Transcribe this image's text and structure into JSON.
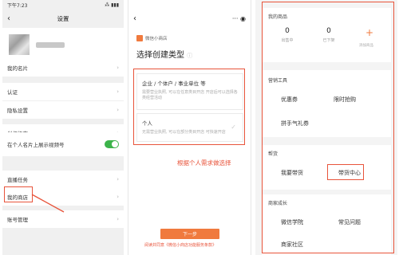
{
  "colors": {
    "accent": "#f07a3e",
    "annotation": "#e8543b",
    "toggle_on": "#3cb34a"
  },
  "panel1": {
    "status": {
      "time": "下午7:23",
      "right": "⁂ ▮▮▮"
    },
    "nav": {
      "back_icon": "chevron-left-icon",
      "title": "设置"
    },
    "items": [
      {
        "label": "我的名片"
      },
      {
        "label": "认证"
      },
      {
        "label": "隐私设置"
      },
      {
        "label": "创作指南"
      },
      {
        "label": "在个人名片上展示视频号"
      },
      {
        "label": "直播任务"
      },
      {
        "label": "我的商店"
      },
      {
        "label": "账号管理"
      }
    ]
  },
  "panel2": {
    "nav": {
      "back_icon": "chevron-left-icon"
    },
    "shop_label": "微信小商店",
    "title": "选择创建类型",
    "options": [
      {
        "label": "企业 / 个体户 / 事业单位 等",
        "desc": "需要营业执照, 可以在任意类目开店 开店后可以选择各类经营活动"
      },
      {
        "label": "个人",
        "desc": "无需营业执照, 可以在部分类目开店 可快速开店"
      }
    ],
    "annotation": "根据个人需求做选择",
    "next_button": "下一步",
    "agree_text": "阅读并同意《微信小商店功能服务条款》"
  },
  "panel3": {
    "section_goods": {
      "title": "我的商品",
      "stats": [
        {
          "value": "0",
          "label": "出售中"
        },
        {
          "value": "0",
          "label": "已下架"
        }
      ],
      "add_label": "添加商品"
    },
    "section_tools": {
      "title": "营销工具",
      "items": [
        "优惠券",
        "限时抢购",
        "拼手气礼券"
      ]
    },
    "section_help": {
      "title": "帮货",
      "items": [
        "我要带货",
        "带货中心"
      ]
    },
    "section_grow": {
      "title": "商家成长",
      "items": [
        "微信学院",
        "常见问题",
        "商家社区"
      ]
    }
  }
}
